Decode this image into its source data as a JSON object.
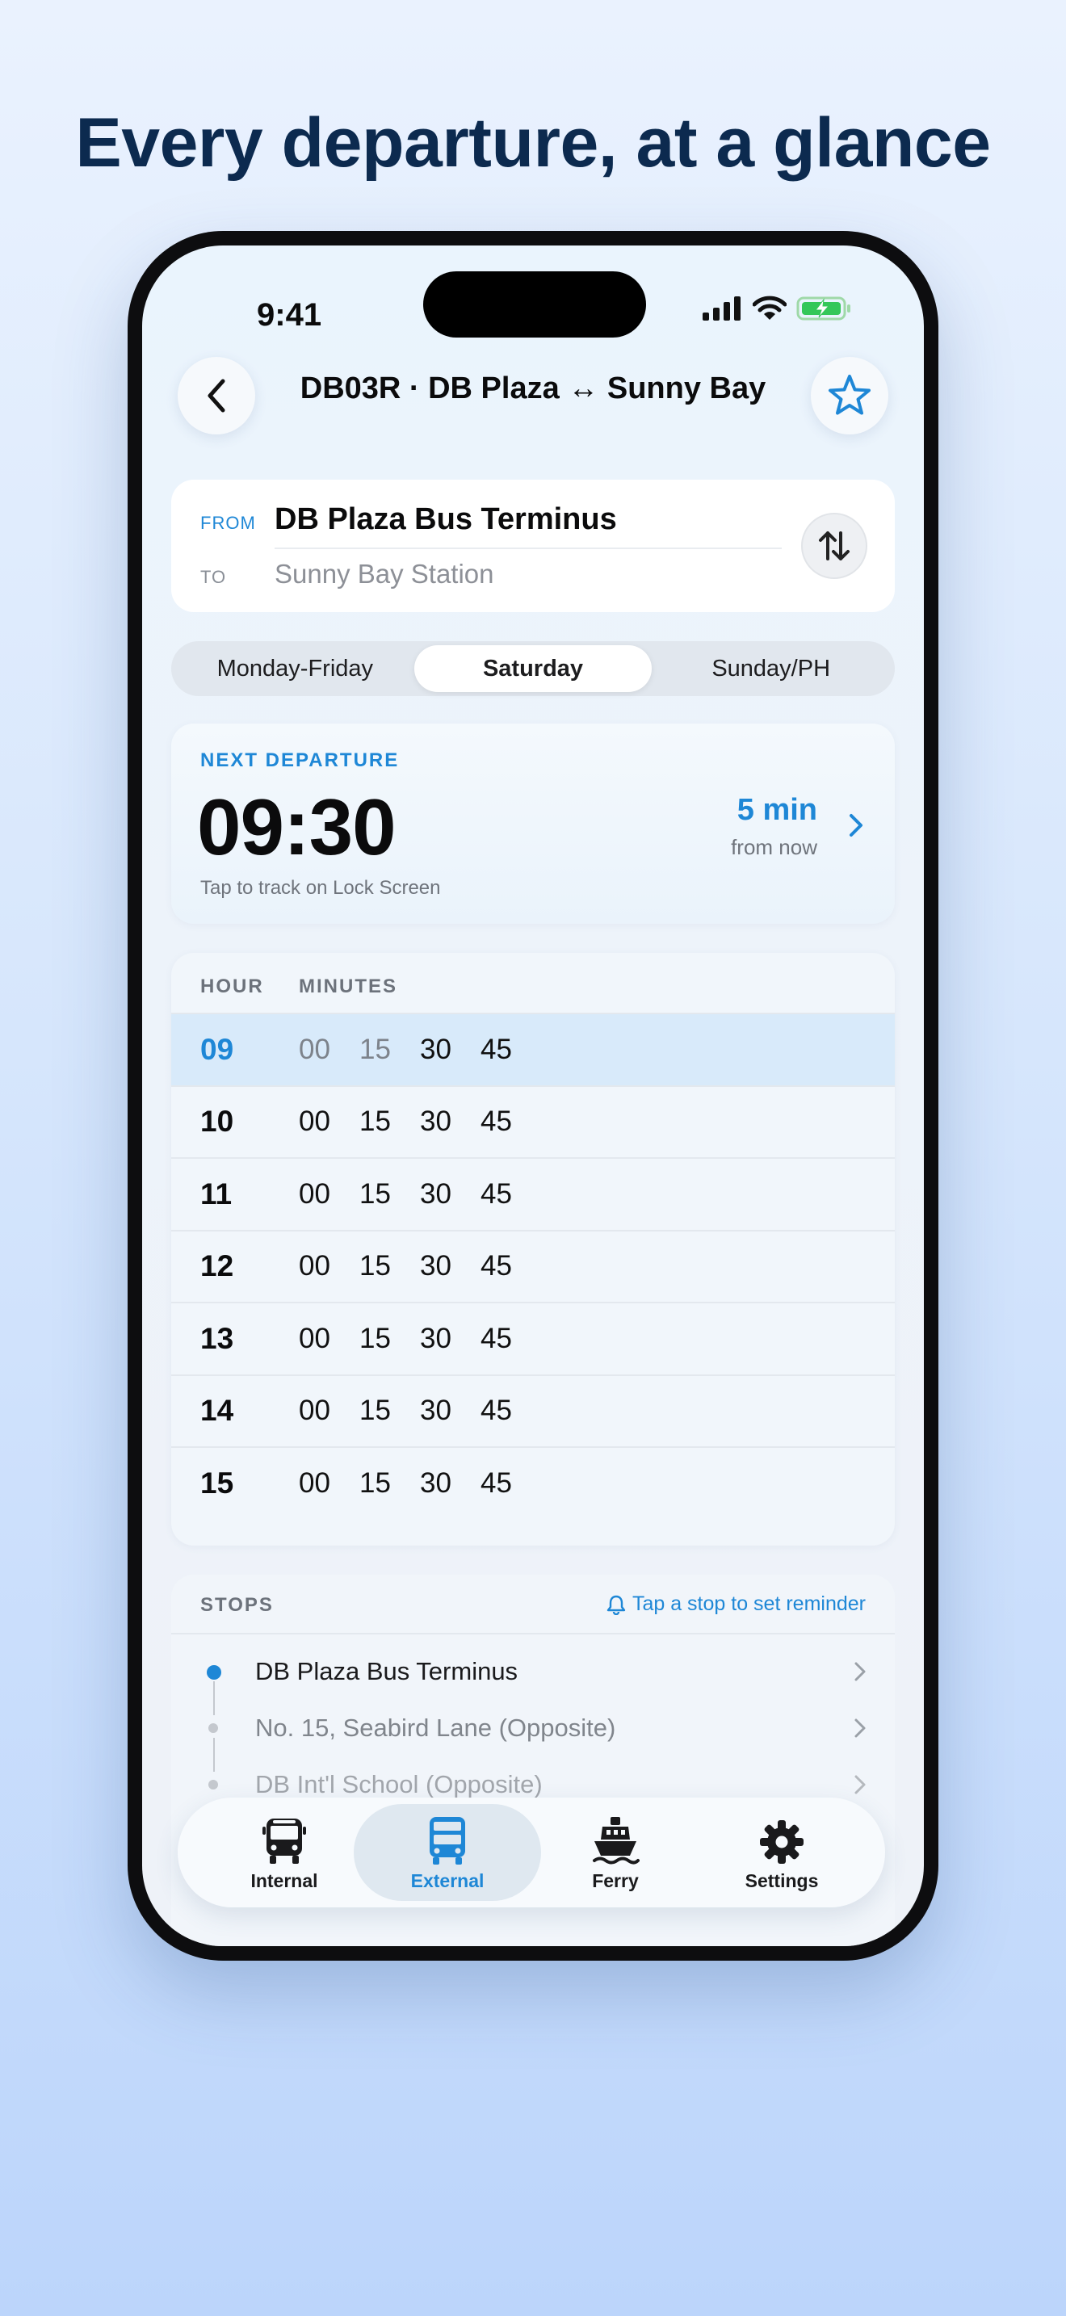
{
  "headline": "Every departure, at a glance",
  "status_bar": {
    "time": "9:41"
  },
  "nav": {
    "title": "DB03R · DB Plaza ↔ Sunny Bay"
  },
  "route": {
    "from_label": "FROM",
    "from_value": "DB Plaza Bus Terminus",
    "to_label": "TO",
    "to_value": "Sunny Bay Station"
  },
  "day_tabs": [
    "Monday-Friday",
    "Saturday",
    "Sunday/PH"
  ],
  "selected_day": "Saturday",
  "next_departure": {
    "label": "NEXT DEPARTURE",
    "time": "09:30",
    "countdown": "5 min",
    "countdown_suffix": "from now",
    "hint": "Tap to track on Lock Screen"
  },
  "timetable": {
    "hour_header": "HOUR",
    "minutes_header": "MINUTES",
    "rows": [
      {
        "hour": "09",
        "minutes": [
          "00",
          "15",
          "30",
          "45"
        ],
        "current": true
      },
      {
        "hour": "10",
        "minutes": [
          "00",
          "15",
          "30",
          "45"
        ]
      },
      {
        "hour": "11",
        "minutes": [
          "00",
          "15",
          "30",
          "45"
        ]
      },
      {
        "hour": "12",
        "minutes": [
          "00",
          "15",
          "30",
          "45"
        ]
      },
      {
        "hour": "13",
        "minutes": [
          "00",
          "15",
          "30",
          "45"
        ]
      },
      {
        "hour": "14",
        "minutes": [
          "00",
          "15",
          "30",
          "45"
        ]
      },
      {
        "hour": "15",
        "minutes": [
          "00",
          "15",
          "30",
          "45"
        ]
      }
    ]
  },
  "stops": {
    "header": "STOPS",
    "hint": "Tap a stop to set reminder",
    "items": [
      "DB Plaza Bus Terminus",
      "No. 15, Seabird Lane (Opposite)",
      "DB Int'l School (Opposite)"
    ]
  },
  "tabs": [
    {
      "label": "Internal",
      "icon": "bus-icon"
    },
    {
      "label": "External",
      "icon": "double-decker-bus-icon",
      "active": true
    },
    {
      "label": "Ferry",
      "icon": "ferry-icon"
    },
    {
      "label": "Settings",
      "icon": "gear-icon"
    }
  ],
  "colors": {
    "accent": "#1e87d6",
    "headline": "#0c2a4f"
  }
}
